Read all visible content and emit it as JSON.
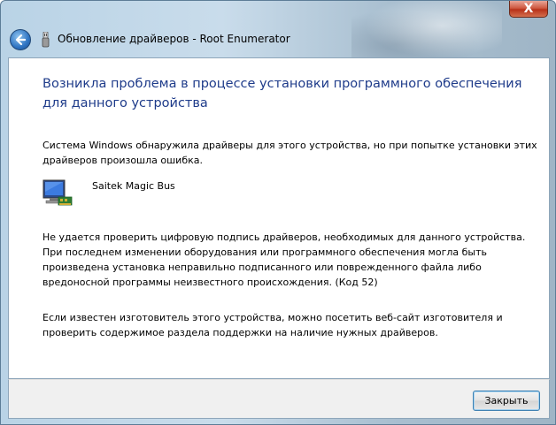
{
  "window": {
    "title": "Обновление драйверов - Root Enumerator",
    "close_glyph": "X"
  },
  "content": {
    "heading": "Возникла проблема в процессе установки программного обеспечения для данного устройства",
    "intro": "Система Windows обнаружила драйверы для этого устройства, но при попытке установки этих драйверов произошла ошибка.",
    "device_name": "Saitek Magic Bus",
    "error_text": "Не удается проверить цифровую подпись драйверов, необходимых для данного устройства. При последнем изменении оборудования или программного обеспечения могла быть произведена установка неправильно подписанного или поврежденного файла либо вредоносной программы неизвестного происхождения. (Код 52)",
    "advice_text": "Если известен изготовитель этого устройства, можно посетить веб-сайт изготовителя и проверить содержимое раздела поддержки на наличие нужных драйверов."
  },
  "footer": {
    "close_label": "Закрыть"
  },
  "icons": {
    "back": "back-arrow-icon",
    "device_manager": "device-manager-icon",
    "device": "computer-device-icon"
  },
  "colors": {
    "heading": "#1e3b8a",
    "close_button": "#c9452c"
  }
}
